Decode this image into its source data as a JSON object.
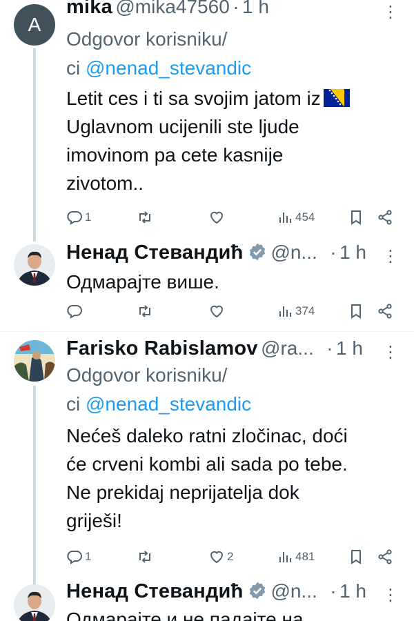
{
  "tweets": [
    {
      "avatar_letter": "A",
      "avatar_color": "#41525d",
      "name": "mika",
      "handle": "@mika47560",
      "dot": "·",
      "time": "1 h",
      "reply_prefix_1": "Odgovor korisniku/",
      "reply_prefix_2": "ci ",
      "reply_mention": "@nenad_stevandic",
      "body_lines": [
        "Letit ces i ti sa svojim jatom iz",
        "Uglavnom ucijenili ste ljude",
        "imovinom pa cete kasnije",
        "zivotom.."
      ],
      "stats": {
        "replies": "1",
        "retweets": "",
        "likes": "",
        "views": "454"
      }
    },
    {
      "name": "Ненад Стевандић",
      "handle": "@n...",
      "dot": "·",
      "time": "1 h",
      "body_lines": [
        "Одмарајте више."
      ],
      "stats": {
        "replies": "",
        "retweets": "",
        "likes": "",
        "views": "374"
      }
    },
    {
      "name": "Farisko Rabislamov",
      "handle": "@ra...",
      "dot": "·",
      "time": "1 h",
      "reply_prefix_1": "Odgovor korisniku/",
      "reply_prefix_2": "ci ",
      "reply_mention": "@nenad_stevandic",
      "body_lines": [
        "Nećeš daleko ratni zločinac, doći",
        "će crveni kombi ali sada po tebe.",
        "Ne prekidaj neprijatelja dok",
        "griješi!"
      ],
      "stats": {
        "replies": "1",
        "retweets": "",
        "likes": "2",
        "views": "481"
      }
    },
    {
      "name": "Ненад Стевандић",
      "handle": "@n...",
      "dot": "·",
      "time": "1 h",
      "body_lines": [
        "Одмарајте и не падајте на"
      ]
    }
  ],
  "more_glyph": "⋮",
  "colors": {
    "accent": "#1d9bf0",
    "muted": "#536471",
    "text": "#0f1419",
    "verified": "#829aab"
  },
  "icons": [
    "reply-icon",
    "retweet-icon",
    "like-icon",
    "views-icon",
    "bookmark-icon",
    "share-icon",
    "verified-icon",
    "bosnia-flag-icon",
    "more-icon"
  ]
}
